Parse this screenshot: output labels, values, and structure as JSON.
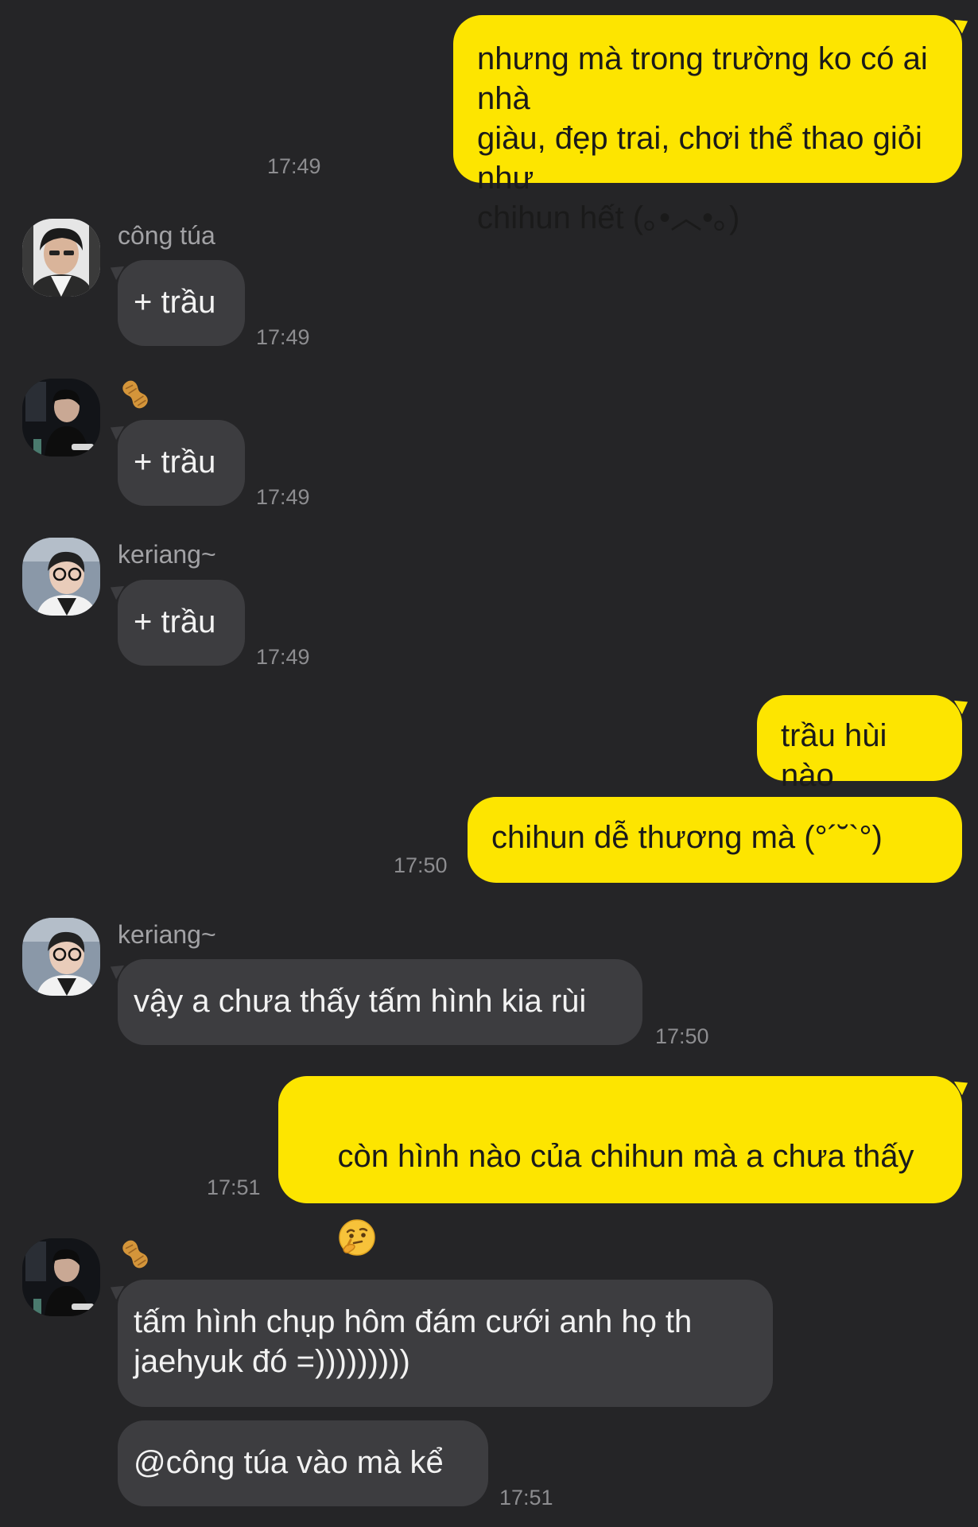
{
  "messages": [
    {
      "text": "nhưng mà trong trường ko có ai nhà\ngiàu, đẹp trai, chơi thể thao giỏi như\nchihun hết (｡•︿•｡)",
      "time": "17:49"
    },
    {
      "sender": "công túa",
      "text": "+ trầu",
      "time": "17:49"
    },
    {
      "sender": "",
      "text": "+ trầu",
      "time": "17:49"
    },
    {
      "sender": "keriang~",
      "text": "+ trầu",
      "time": "17:49"
    },
    {
      "text": "trầu hùi nào"
    },
    {
      "text": "chihun dễ thương mà (°´˘`°)",
      "time": "17:50"
    },
    {
      "sender": "keriang~",
      "text": "vậy a chưa thấy tấm hình kia rùi",
      "time": "17:50"
    },
    {
      "text": "còn hình nào của chihun mà a chưa thấy",
      "time": "17:51"
    },
    {
      "sender": "",
      "text": "tấm hình chụp hôm đám cưới anh họ th\njaehyuk đó =)))))))))"
    },
    {
      "text": "@công túa vào mà kể",
      "time": "17:51"
    }
  ],
  "colors": {
    "background": "#252527",
    "outgoing_bubble": "#fde500",
    "incoming_bubble": "#3d3d40",
    "timestamp": "#8d8d90",
    "sender_name": "#a2a2a5"
  },
  "icons": {
    "peanut": "peanut-icon",
    "thinking_face": "thinking-face-icon"
  }
}
